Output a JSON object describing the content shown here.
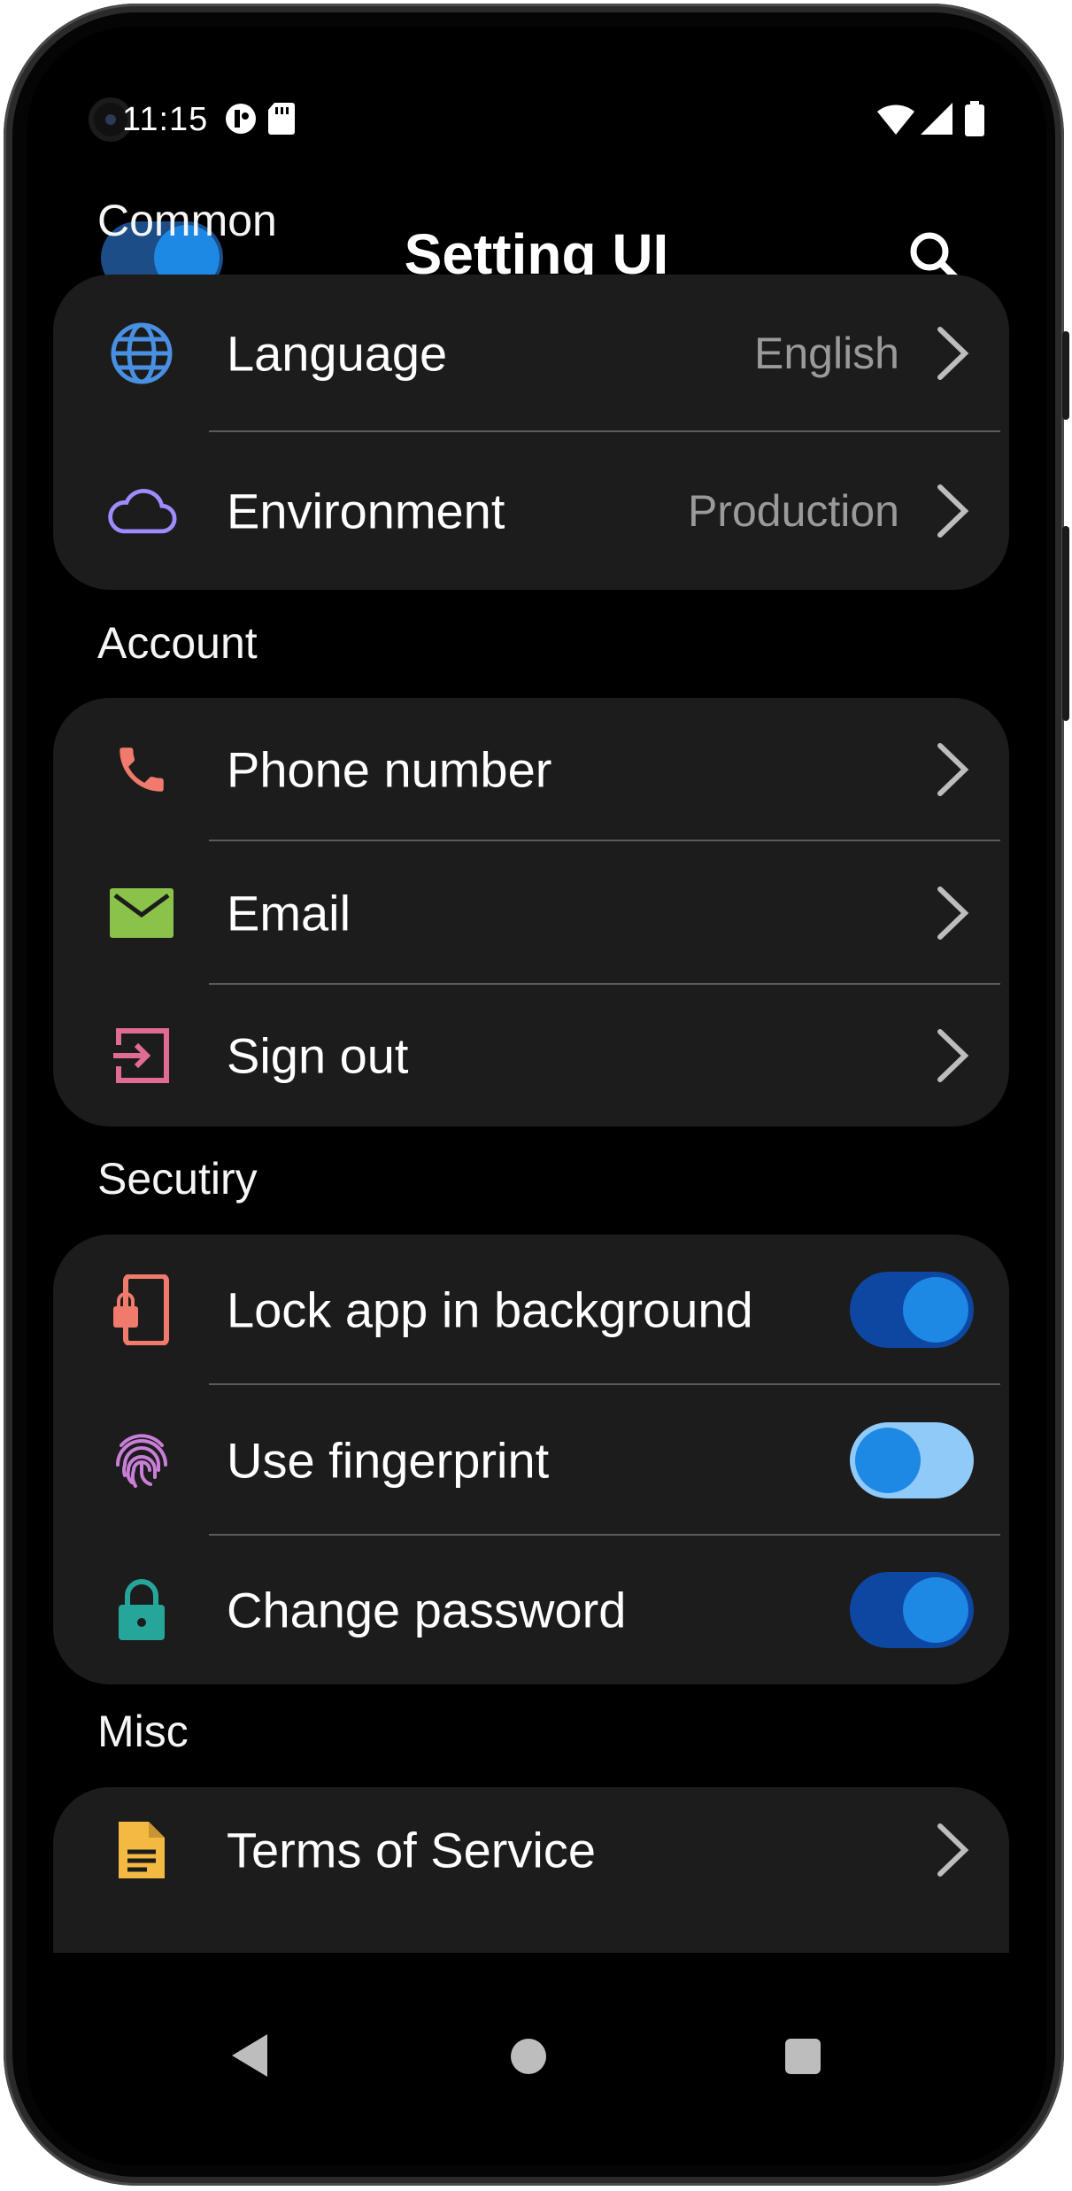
{
  "status_bar": {
    "time": "11:15"
  },
  "appbar": {
    "title": "Setting UI",
    "theme_toggle_on": true
  },
  "sections": {
    "common": {
      "header": "Common",
      "items": [
        {
          "label": "Language",
          "value": "English"
        },
        {
          "label": "Environment",
          "value": "Production"
        }
      ]
    },
    "account": {
      "header": "Account",
      "items": [
        {
          "label": "Phone number"
        },
        {
          "label": "Email"
        },
        {
          "label": "Sign out"
        }
      ]
    },
    "security": {
      "header": "Secutiry",
      "items": [
        {
          "label": "Lock app in background",
          "enabled": true
        },
        {
          "label": "Use fingerprint",
          "enabled": false
        },
        {
          "label": "Change password",
          "enabled": true
        }
      ]
    },
    "misc": {
      "header": "Misc",
      "items": [
        {
          "label": "Terms of Service"
        }
      ]
    }
  },
  "colors": {
    "background": "#000000",
    "card": "#1c1c1c",
    "accent": "#1e88e5",
    "globe_icon": "#4a90e2",
    "cloud_icon": "#9c8cff",
    "phone_icon": "#f07b6c",
    "email_icon": "#8bc34a",
    "signout_icon": "#e06c91",
    "lock_phone_icon": "#f07b6c",
    "fingerprint_icon": "#c97ed8",
    "padlock_icon": "#26a69a",
    "document_icon": "#f4b942"
  }
}
